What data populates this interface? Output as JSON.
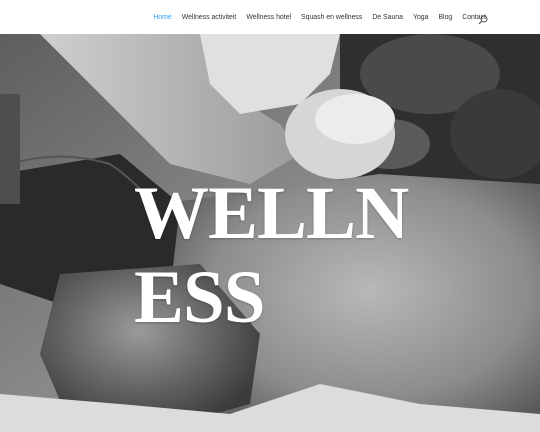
{
  "nav": {
    "items": [
      {
        "label": "Home",
        "active": true
      },
      {
        "label": "Wellness activiteit",
        "active": false
      },
      {
        "label": "Wellness hotel",
        "active": false
      },
      {
        "label": "Squash en wellness",
        "active": false
      },
      {
        "label": "De Sauna",
        "active": false
      },
      {
        "label": "Yoga",
        "active": false
      },
      {
        "label": "Blog",
        "active": false
      },
      {
        "label": "Contact",
        "active": false
      }
    ],
    "search_icon": "search-icon"
  },
  "colors": {
    "accent": "#2ea3f2",
    "nav_text": "#333333",
    "hero_title": "#ffffff"
  },
  "hero": {
    "title": "WELLNESS",
    "image": "massage-photo-grayscale"
  }
}
